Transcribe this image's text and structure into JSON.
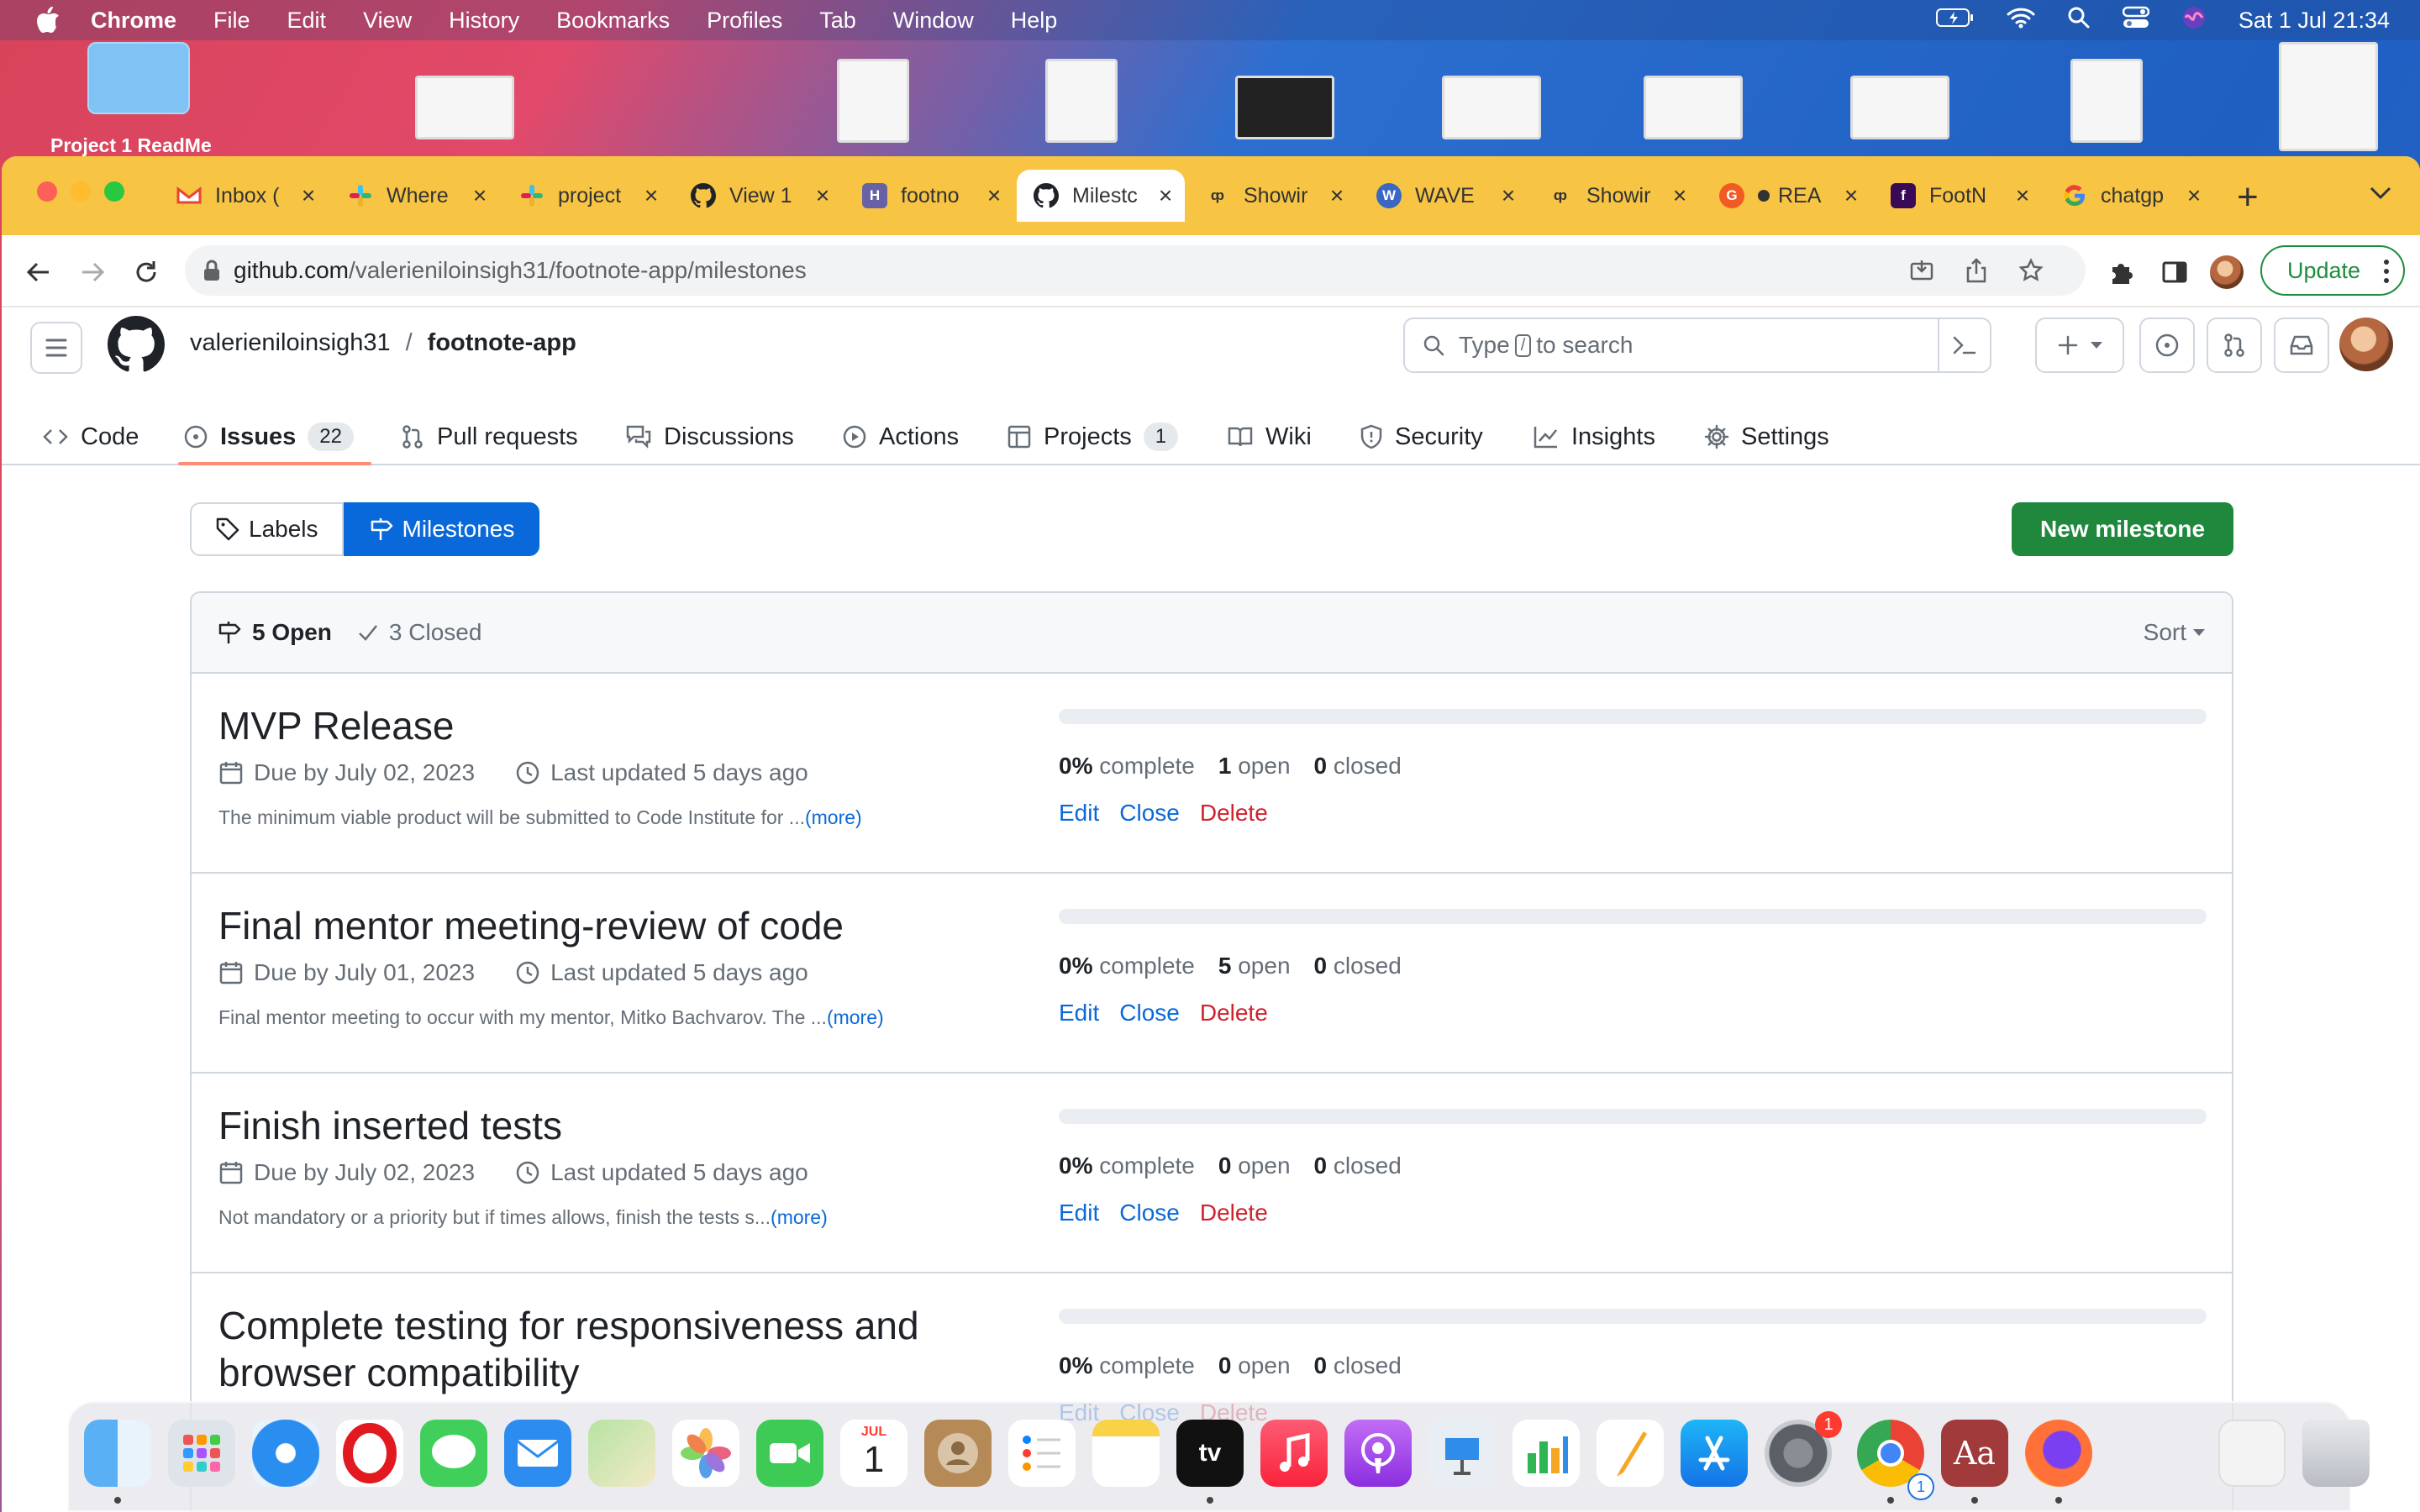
{
  "menubar": {
    "app": "Chrome",
    "items": [
      "File",
      "Edit",
      "View",
      "History",
      "Bookmarks",
      "Profiles",
      "Tab",
      "Window",
      "Help"
    ],
    "clock": "Sat 1 Jul  21:34"
  },
  "desktop": {
    "folder_label": "Project 1 ReadMe"
  },
  "tabs": [
    {
      "label": "Inbox (",
      "icon": "gmail-icon",
      "color": "#ea4335"
    },
    {
      "label": "Where",
      "icon": "slack-icon",
      "color": "#4a154b"
    },
    {
      "label": "project",
      "icon": "slack-icon",
      "color": "#4a154b"
    },
    {
      "label": "View 1",
      "icon": "github-icon",
      "color": "#1f2328"
    },
    {
      "label": "footno",
      "icon": "heroku-icon",
      "color": "#6762a6"
    },
    {
      "label": "Milestc",
      "icon": "github-icon",
      "color": "#1f2328",
      "active": true
    },
    {
      "label": "Showir",
      "icon": "codeinstitute-icon",
      "color": "#333333"
    },
    {
      "label": "WAVE",
      "icon": "wave-icon",
      "color": "#3a67c4"
    },
    {
      "label": "Showir",
      "icon": "codeinstitute-icon",
      "color": "#333333"
    },
    {
      "label": "REA",
      "icon": "grammarly-icon",
      "color": "#f15a24"
    },
    {
      "label": "FootN",
      "icon": "footnote-icon",
      "color": "#3b0a57"
    },
    {
      "label": "chatgp",
      "icon": "google-icon",
      "color": "#4285f4"
    }
  ],
  "address": {
    "host": "github.com",
    "path": "/valerieniloinsigh31/footnote-app/milestones"
  },
  "update_label": "Update",
  "repo": {
    "owner": "valerieniloinsigh31",
    "separator": "/",
    "name": "footnote-app"
  },
  "search": {
    "prefix": "Type",
    "key": "/",
    "suffix": "to search"
  },
  "reponav": [
    {
      "label": "Code",
      "icon": "code-icon"
    },
    {
      "label": "Issues",
      "icon": "issue-opened-icon",
      "count": "22",
      "selected": true
    },
    {
      "label": "Pull requests",
      "icon": "git-pull-request-icon"
    },
    {
      "label": "Discussions",
      "icon": "comment-discussion-icon"
    },
    {
      "label": "Actions",
      "icon": "play-icon"
    },
    {
      "label": "Projects",
      "icon": "table-icon",
      "count": "1"
    },
    {
      "label": "Wiki",
      "icon": "book-icon"
    },
    {
      "label": "Security",
      "icon": "shield-icon"
    },
    {
      "label": "Insights",
      "icon": "graph-icon"
    },
    {
      "label": "Settings",
      "icon": "gear-icon"
    }
  ],
  "subnav": {
    "labels": "Labels",
    "milestones": "Milestones"
  },
  "new_milestone": "New milestone",
  "filter": {
    "open": "5 Open",
    "closed": "3 Closed",
    "sort": "Sort"
  },
  "milestones": [
    {
      "title": "MVP Release",
      "due": "Due by July 02, 2023",
      "updated": "Last updated 5 days ago",
      "description": "The minimum viable product will be submitted to Code Institute for ...",
      "more": "(more)",
      "percent": "0%",
      "percent_label": "complete",
      "progress": 0,
      "open": "1",
      "open_label": "open",
      "closed": "0",
      "closed_label": "closed"
    },
    {
      "title": "Final mentor meeting-review of code",
      "due": "Due by July 01, 2023",
      "updated": "Last updated 5 days ago",
      "description": "Final mentor meeting to occur with my mentor, Mitko Bachvarov. The ...",
      "more": "(more)",
      "percent": "0%",
      "percent_label": "complete",
      "progress": 0,
      "open": "5",
      "open_label": "open",
      "closed": "0",
      "closed_label": "closed"
    },
    {
      "title": "Finish inserted tests",
      "due": "Due by July 02, 2023",
      "updated": "Last updated 5 days ago",
      "description": "Not mandatory or a priority but if times allows, finish the tests s...",
      "more": "(more)",
      "percent": "0%",
      "percent_label": "complete",
      "progress": 0,
      "open": "0",
      "open_label": "open",
      "closed": "0",
      "closed_label": "closed"
    },
    {
      "title": "Complete testing for responsiveness and browser compatibility",
      "due": "",
      "updated": "",
      "description": "",
      "more": "",
      "percent": "0%",
      "percent_label": "complete",
      "progress": 0,
      "open": "0",
      "open_label": "open",
      "closed": "0",
      "closed_label": "closed"
    }
  ],
  "actions": {
    "edit": "Edit",
    "close": "Close",
    "delete": "Delete"
  },
  "dock": {
    "calendar_month": "JUL",
    "calendar_day": "1",
    "settings_badge": "1",
    "chrome_badge": "1",
    "apps": [
      "finder",
      "launchpad",
      "safari",
      "opera",
      "messages",
      "mail",
      "maps",
      "photos",
      "facetime",
      "calendar",
      "contacts",
      "reminders",
      "notes",
      "apple-tv",
      "music",
      "podcasts",
      "keynote",
      "numbers",
      "pages",
      "app-store",
      "system-settings",
      "chrome",
      "dictionary",
      "firefox",
      "downloads",
      "trash"
    ]
  },
  "colors": {
    "accent": "#0969da",
    "primary_button": "#1f883d",
    "danger": "#cf222e",
    "tabstrip": "#f7c444"
  }
}
